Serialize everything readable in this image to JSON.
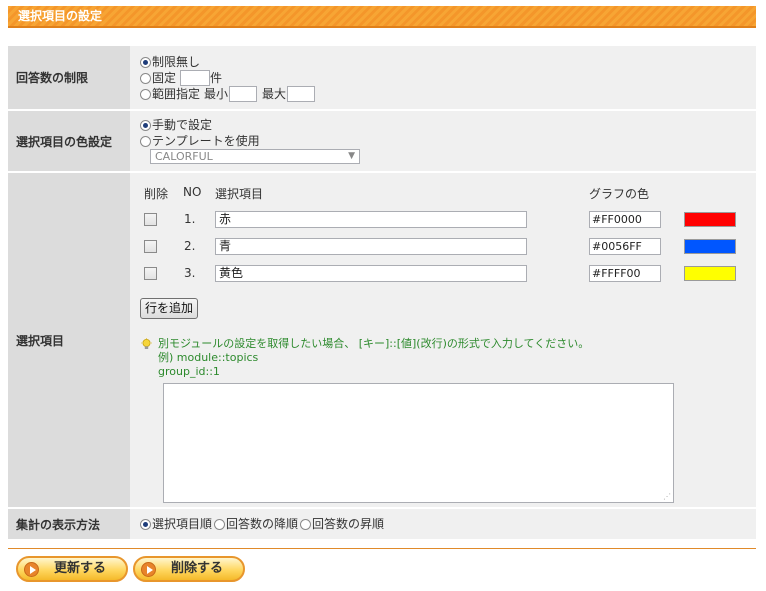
{
  "panel": {
    "title": "選択項目の設定"
  },
  "answer_limit": {
    "label": "回答数の制限",
    "options": {
      "unlimited": "制限無し",
      "fixed": "固定",
      "fixed_unit": "件",
      "range": "範囲指定",
      "min": "最小",
      "max": "最大"
    },
    "selected": "unlimited"
  },
  "color_setting": {
    "label": "選択項目の色設定",
    "options": {
      "manual": "手動で設定",
      "template": "テンプレートを使用"
    },
    "selected": "manual",
    "template_value": "CALORFUL"
  },
  "items": {
    "label": "選択項目",
    "columns": {
      "delete": "削除",
      "no": "NO",
      "item": "選択項目",
      "graph_color": "グラフの色"
    },
    "rows": [
      {
        "no": "1.",
        "name": "赤",
        "color": "#FF0000"
      },
      {
        "no": "2.",
        "name": "青",
        "color": "#0056FF"
      },
      {
        "no": "3.",
        "name": "黄色",
        "color": "#FFFF00"
      }
    ],
    "add_row_label": "行を追加",
    "hint": {
      "line1": "別モジュールの設定を取得したい場合、 [キー]::[値](改行)の形式で入力してください。",
      "line2": "例) module::topics",
      "line3": "group_id::1"
    }
  },
  "display_method": {
    "label": "集計の表示方法",
    "options": {
      "item_order": "選択項目順",
      "desc": "回答数の降順",
      "asc": "回答数の昇順"
    },
    "selected": "item_order"
  },
  "buttons": {
    "update": "更新する",
    "delete": "削除する"
  },
  "colors": {
    "accent": "#f4962a",
    "hint": "#2d8a2d"
  }
}
